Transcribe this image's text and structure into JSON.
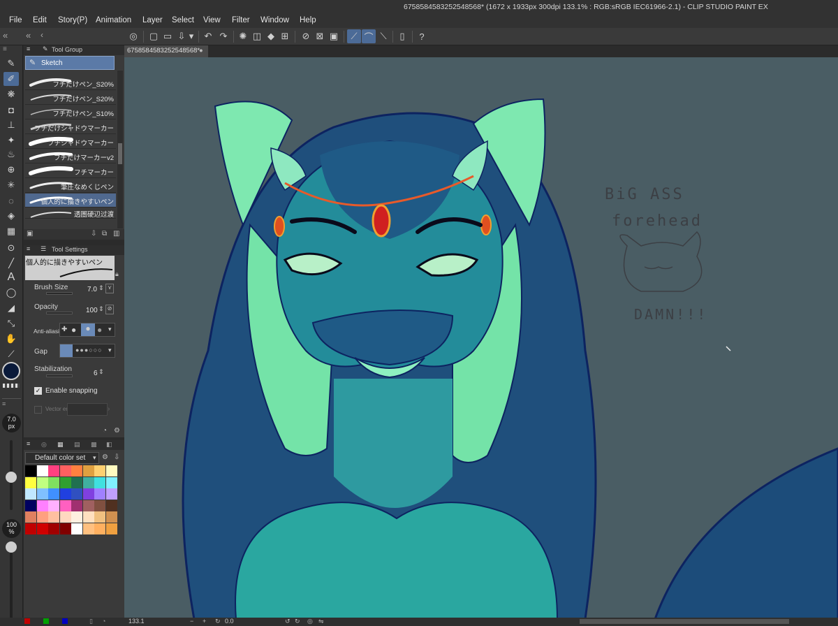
{
  "window": {
    "title": "6758584583252548568* (1672 x 1933px 300dpi 133.1% : RGB:sRGB IEC61966-2.1) - CLIP STUDIO PAINT EX"
  },
  "menu": [
    "File",
    "Edit",
    "Story(P)",
    "Animation",
    "Layer",
    "Select",
    "View",
    "Filter",
    "Window",
    "Help"
  ],
  "panels": {
    "tool_group_title": "Tool Group",
    "tool_group_selected": "Sketch",
    "sub_tools": [
      "フチだけペン_S20%",
      "フチだけペン_S20%",
      "フチだけペン_S10%",
      "フチだけシャドウマーカー",
      "フチシャドウマーカー",
      "フチだけマーカーv2",
      "フチマーカー",
      "筆圧なめくじペン",
      "個人的に描きやすいペン",
      "透圏硬辺过渡"
    ],
    "sub_tool_selected_index": 8,
    "tool_settings_title": "Tool Settings",
    "tool_settings_brush_name": "個人的に描きやすいペン",
    "brush_size_label": "Brush Size",
    "brush_size_value": "7.0",
    "opacity_label": "Opacity",
    "opacity_value": "100",
    "antialias_label": "Anti-aliasin",
    "gap_label": "Gap",
    "stabilization_label": "Stabilization",
    "stabilization_value": "6",
    "enable_snapping_label": "Enable snapping",
    "enable_snapping_checked": true,
    "vector_label": "Vector era",
    "brush_size_display": "7.0",
    "brush_size_unit": "px",
    "opacity_display": "100",
    "opacity_unit": "%"
  },
  "color_set": {
    "name": "Default color set",
    "swatches": [
      "#000000",
      "#ffffff",
      "#ff4080",
      "#ff6060",
      "#ff8040",
      "#e0a040",
      "#ffd070",
      "#fffac0",
      "#ffff40",
      "#c0ff80",
      "#80e060",
      "#30a030",
      "#207050",
      "#40b0a0",
      "#40e0e0",
      "#80f0ff",
      "#c0e8ff",
      "#80c0ff",
      "#4090ff",
      "#2040e0",
      "#3050c0",
      "#8040e0",
      "#a080ff",
      "#c0a0ff",
      "#000060",
      "#ff80ff",
      "#ffb0ff",
      "#ff60c0",
      "#a03070",
      "#a06060",
      "#805040",
      "#503020",
      "#e08060",
      "#ffa080",
      "#ffc0a0",
      "#ffd8c0",
      "#fff0e0",
      "#ffe0c0",
      "#f0c080",
      "#d09050",
      "#c00000",
      "#d00000",
      "#a00000",
      "#800000",
      "#ffffff",
      "#ffc080",
      "#ffb060",
      "#f0a040"
    ]
  },
  "canvas": {
    "tab_label": "6758584583252548568*",
    "notes": [
      "BiG ASS",
      "forehead",
      "DAMN!!!"
    ]
  },
  "status": {
    "zoom": "133.1",
    "angle": "0.0"
  },
  "colors": {
    "accent": "#4c6b97",
    "canvas_bg": "#4a5d64",
    "main_color": "#0a1a3a",
    "sub_color": "#ffffff"
  }
}
